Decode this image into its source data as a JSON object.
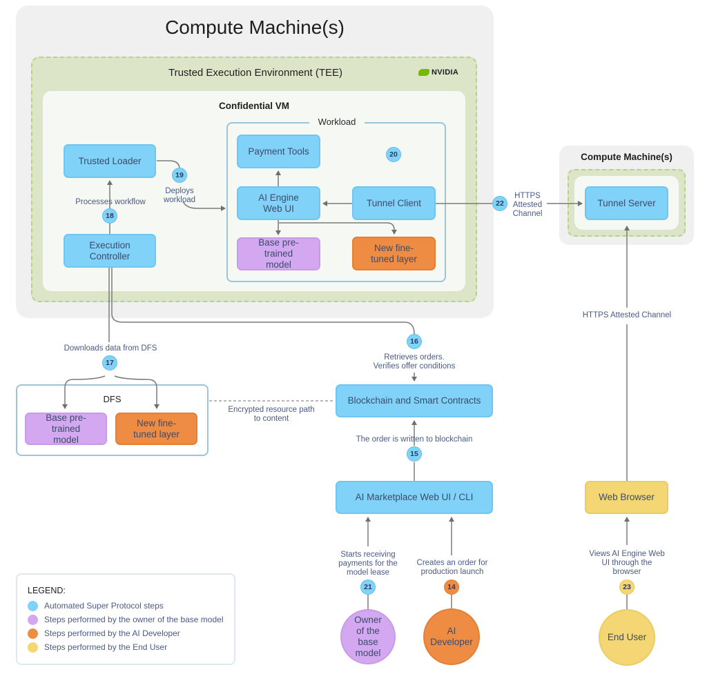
{
  "colors": {
    "automated": "#80d2f8",
    "owner": "#d3a8f1",
    "developer": "#ee8c44",
    "end_user": "#f4d774",
    "tee_green": "#dde5c8",
    "nvidia_green": "#76b900"
  },
  "main_machine": {
    "title": "Compute Machine(s)",
    "tee": {
      "title": "Trusted Execution Environment (TEE)",
      "vendor_logo": "NVIDIA",
      "confidential_vm": {
        "title": "Confidential VM",
        "trusted_loader": "Trusted Loader",
        "execution_controller": "Execution Controller",
        "workload": {
          "title": "Workload",
          "payment_tools": "Payment Tools",
          "ai_engine": "AI Engine Web UI",
          "tunnel_client": "Tunnel Client",
          "base_model": "Base pre-trained model",
          "fine_tuned": "New fine-tuned layer"
        }
      }
    }
  },
  "remote_machine": {
    "title": "Compute Machine(s)",
    "tunnel_server": "Tunnel Server"
  },
  "dfs": {
    "title": "DFS",
    "base_model": "Base pre-trained model",
    "fine_tuned": "New fine-tuned layer"
  },
  "blockchain": "Blockchain and Smart Contracts",
  "marketplace": "AI Marketplace Web UI / CLI",
  "web_browser": "Web Browser",
  "actors": {
    "owner": "Owner of the base model",
    "developer": "AI Developer",
    "end_user": "End User"
  },
  "steps": {
    "s14": {
      "num": "14",
      "text": "Creates an order for production launch"
    },
    "s15": {
      "num": "15",
      "text": "The order is written to blockchain"
    },
    "s16": {
      "num": "16",
      "text": "Retrieves orders. Verifies offer conditions"
    },
    "s17": {
      "num": "17",
      "text": "Downloads data from DFS"
    },
    "s18": {
      "num": "18",
      "text": "Processes workflow"
    },
    "s19": {
      "num": "19",
      "text": "Deploys workload"
    },
    "s20": {
      "num": "20"
    },
    "s21": {
      "num": "21",
      "text": "Starts receiving payments for the model lease"
    },
    "s22": {
      "num": "22",
      "text": "HTTPS Attested Channel"
    },
    "s23": {
      "num": "23",
      "text": "Views AI Engine Web UI through the browser"
    }
  },
  "edge_labels": {
    "encrypted_path": "Encrypted resource path to content",
    "https_channel": "HTTPS Attested Channel"
  },
  "legend": {
    "title": "LEGEND:",
    "items": [
      {
        "label": "Automated Super Protocol steps",
        "color": "#80d2f8"
      },
      {
        "label": "Steps performed by the owner of the base model",
        "color": "#d3a8f1"
      },
      {
        "label": "Steps performed by the AI Developer",
        "color": "#ee8c44"
      },
      {
        "label": "Steps performed by the End User",
        "color": "#f4d774"
      }
    ]
  }
}
